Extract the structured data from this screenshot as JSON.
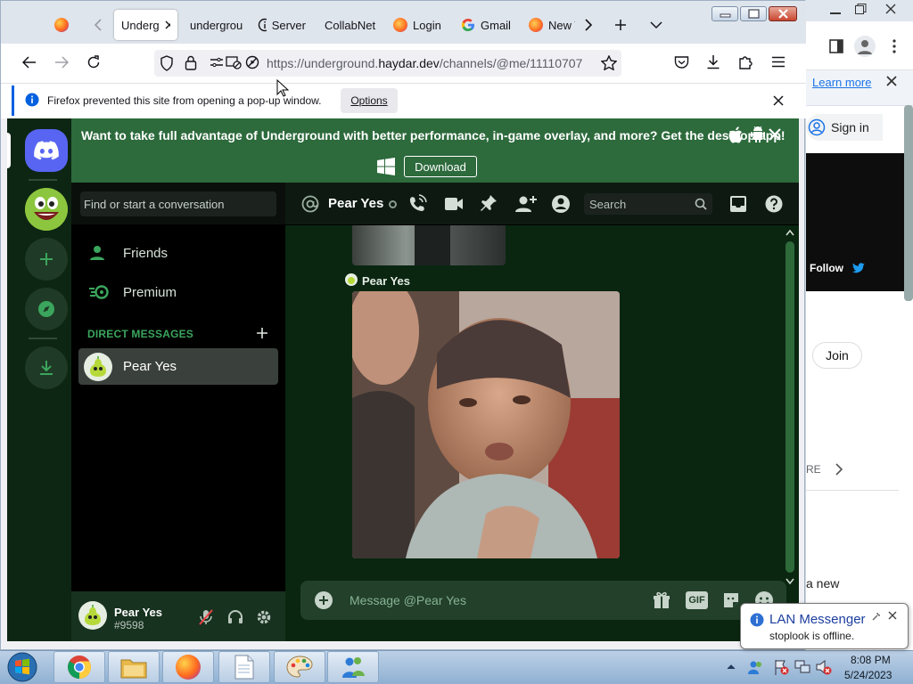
{
  "background_window": {
    "learn_more": "Learn more",
    "sign_in": "Sign in",
    "follow": "Follow",
    "join": "Join",
    "partial_re": "RE",
    "partial_new": "a new"
  },
  "browser": {
    "tabs": [
      {
        "label": "Underg",
        "active": true
      },
      {
        "label": "undergrou"
      },
      {
        "label": "Server"
      },
      {
        "label": "CollabNet"
      },
      {
        "label": "Login"
      },
      {
        "label": "Gmail"
      },
      {
        "label": "New T"
      }
    ],
    "url_prefix": "https://underground.",
    "url_domain": "haydar.dev",
    "url_rest": "/channels/@me/11110707",
    "notification": "Firefox prevented this site from opening a pop-up window.",
    "options_label": "Options"
  },
  "discord": {
    "banner_text": "Want to take full advantage of Underground with better performance, in-game overlay, and more? Get the desktop app!",
    "download_label": "Download",
    "find_placeholder": "Find or start a conversation",
    "nav": [
      {
        "label": "Friends",
        "icon": "friends-icon"
      },
      {
        "label": "Premium",
        "icon": "nitro-icon"
      }
    ],
    "dm_header": "DIRECT MESSAGES",
    "dm_items": [
      {
        "name": "Pear Yes",
        "selected": true
      }
    ],
    "chat_header_name": "Pear Yes",
    "search_placeholder": "Search",
    "message_author": "Pear Yes",
    "composer_placeholder": "Message @Pear Yes",
    "gif_label": "GIF",
    "user": {
      "name": "Pear Yes",
      "tag": "#9598"
    },
    "colors": {
      "accent_green": "#2d6a3c",
      "brand": "#5865f2"
    }
  },
  "taskbar": {
    "time": "8:08 PM",
    "date": "5/24/2023"
  },
  "toast": {
    "title": "LAN Messenger",
    "body": "stoplook is offline."
  }
}
